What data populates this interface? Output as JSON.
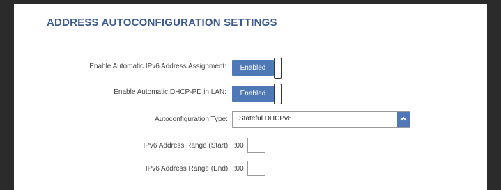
{
  "section": {
    "title": "ADDRESS AUTOCONFIGURATION SETTINGS"
  },
  "rows": {
    "auto_ipv6": {
      "label": "Enable Automatic IPv6 Address Assignment:",
      "value": "Enabled"
    },
    "dhcp_pd": {
      "label": "Enable Automatic DHCP-PD in LAN:",
      "value": "Enabled"
    },
    "autoconfig_type": {
      "label": "Autoconfiguration Type:",
      "value": "Stateful DHCPv6"
    },
    "range_start": {
      "label": "IPv6 Address Range (Start):",
      "prefix": "::00",
      "value": ""
    },
    "range_end": {
      "label": "IPv6 Address Range (End):",
      "prefix": "::00",
      "value": ""
    }
  },
  "colors": {
    "accent": "#4e78b6",
    "title": "#3b5a8e"
  },
  "icons": {
    "select_arrow": "chevron-up-icon"
  }
}
